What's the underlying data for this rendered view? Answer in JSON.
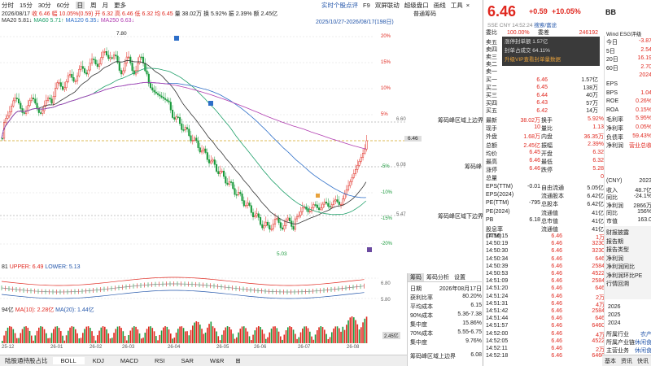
{
  "toolbar": {
    "items": [
      "分时",
      "15分",
      "30分",
      "60分",
      "日",
      "周",
      "月",
      "更多"
    ],
    "active": "日"
  },
  "chart_toolbar": {
    "items": [
      "实时个股点评",
      "F9",
      "双屏联动",
      "超级盘口",
      "画线",
      "工具"
    ],
    "close": "×"
  },
  "ohlc": {
    "date": "2026/08/17",
    "close": "收 6.46",
    "change": "幅 10.05%(0.59)",
    "open": "开 6.32",
    "high": "高 6.46",
    "low": "低 6.32",
    "prevclose": "均 6.45",
    "volume": "量 38.02万",
    "turnover": "换 5.92%",
    "amplitude": "振 2.39%",
    "amount": "额 2.45亿"
  },
  "ma": {
    "ma20": "MA20 5.81↓",
    "ma60": "MA60 5.71↑",
    "ma120": "MA120 6.35↓",
    "ma250": "MA250 6.63↓"
  },
  "range_label": "2025/10/27-2026/08/17(198日)",
  "chip_title": "普通筹码",
  "price_axis": [
    "20%",
    "15%",
    "10%",
    "5%",
    "",
    "-5%",
    "-10%",
    "-15%",
    "-20%"
  ],
  "price_marks": {
    "high": "7.80",
    "low": "5.03",
    "close_tag": "6.46",
    "r660": "6.60",
    "r608": "6.08",
    "r547": "5.47"
  },
  "chip_labels": {
    "upper": "筹码峰区域上边界",
    "peak": "筹码峰",
    "lower": "筹码峰区域下边界"
  },
  "boll": {
    "label": "81",
    "upper": "UPPER: 6.49",
    "lower": "LOWER: 5.13",
    "axis": [
      "6.80",
      "5.80"
    ]
  },
  "vol": {
    "label": "94亿",
    "ma10": "MA(10): 2.28亿",
    "ma20": "MA(20): 1.44亿",
    "axis": [
      "2.45亿"
    ]
  },
  "x_dates": [
    "25-12",
    "26-01",
    "26-02",
    "26-03",
    "26-04",
    "26-05",
    "26-06",
    "26-07",
    "26-08"
  ],
  "bottom_tabs": [
    "陆股通持股占比",
    "BOLL",
    "KDJ",
    "MACD",
    "RSI",
    "SAR",
    "W&R"
  ],
  "bottom_active": "BOLL",
  "chip_panel": {
    "tabs": [
      "筹码",
      "筹码分析",
      "设置"
    ],
    "rows": [
      [
        "日期",
        "2026年08月17日"
      ],
      [
        "获利比率",
        "80.20%"
      ],
      [
        "平均成本",
        "6.15"
      ],
      [
        "90%成本",
        "5.36-7.38"
      ],
      [
        "集中度",
        "15.86%"
      ],
      [
        "70%成本",
        "5.55-6.75"
      ],
      [
        "集中度",
        "9.76%"
      ]
    ],
    "footer": [
      "筹码峰区域上边界",
      "6.08"
    ]
  },
  "quote": {
    "price": "6.46",
    "change": "+0.59",
    "pct": "+10.05%",
    "sub": "SSE CNY 14:52:24",
    "sub2": "搜索/富途",
    "sub3": "BB",
    "esg": "Wind ESG评级"
  },
  "orderbook_header": [
    [
      "委比",
      "100.00%",
      "委差",
      "246192"
    ]
  ],
  "limit_box": [
    "涨停封单额 1.57亿",
    "封单占成交 64.11%",
    "升级VIP查看封单量数据"
  ],
  "asks": [
    [
      "卖五",
      "",
      ""
    ],
    [
      "卖四",
      "",
      ""
    ],
    [
      "卖三",
      "",
      ""
    ],
    [
      "卖二",
      "",
      ""
    ],
    [
      "卖一",
      "",
      ""
    ]
  ],
  "bids": [
    [
      "买一",
      "6.46",
      "1.57亿"
    ],
    [
      "买二",
      "6.45",
      "138万"
    ],
    [
      "买三",
      "6.44",
      "40万"
    ],
    [
      "买四",
      "6.43",
      "57万"
    ],
    [
      "买五",
      "6.42",
      "14万"
    ]
  ],
  "stats": [
    [
      "最新",
      "38.02万",
      "换手",
      "5.92%"
    ],
    [
      "现手",
      "10",
      "量比",
      "1.13"
    ],
    [
      "外盘",
      "1.68万",
      "内盘",
      "36.35万"
    ],
    [
      "总额",
      "2.45亿",
      "振幅",
      "2.39%"
    ],
    [
      "均价",
      "6.45",
      "开盘",
      "6.32"
    ],
    [
      "最高",
      "6.46",
      "最低",
      "6.32"
    ],
    [
      "涨停",
      "6.46",
      "跌停",
      "5.28"
    ],
    [
      "总量",
      "",
      "",
      "0"
    ]
  ],
  "fin": [
    [
      "EPS(TTM)",
      "-0.01",
      "自由流通",
      "5.05亿"
    ],
    [
      "EPS(2024)",
      "",
      "流通股本",
      "6.42亿"
    ],
    [
      "PE(TTM)",
      "-795",
      "总股本",
      "6.42亿"
    ],
    [
      "PE(2024)",
      "",
      "流通值",
      "41亿"
    ],
    [
      "PB",
      "6.18",
      "总市值",
      "41亿"
    ],
    [
      "股息率(TTM)",
      "",
      "流通值",
      "41亿"
    ]
  ],
  "ticks": [
    [
      "14:50:15",
      "6.46",
      "1万"
    ],
    [
      "14:50:19",
      "6.46",
      "3230"
    ],
    [
      "14:50:30",
      "6.46",
      "3230"
    ],
    [
      "14:50:34",
      "6.46",
      "646"
    ],
    [
      "14:50:39",
      "6.46",
      "2584"
    ],
    [
      "14:50:53",
      "6.46",
      "4522"
    ],
    [
      "14:51:09",
      "6.46",
      "2584"
    ],
    [
      "14:51:20",
      "6.46",
      "646"
    ],
    [
      "14:51:24",
      "6.46",
      "2万"
    ],
    [
      "14:51:31",
      "6.46",
      "4万"
    ],
    [
      "14:51:42",
      "6.46",
      "2584"
    ],
    [
      "14:51:44",
      "6.46",
      "646"
    ],
    [
      "14:51:57",
      "6.46",
      "6460"
    ],
    [
      "14:52:00",
      "6.46",
      "4万"
    ],
    [
      "14:52:05",
      "6.46",
      "4522"
    ],
    [
      "14:52:11",
      "6.46",
      "2万"
    ],
    [
      "14:52:18",
      "6.46",
      "6460"
    ]
  ],
  "right_stats": [
    [
      "今日",
      "-3.87"
    ],
    [
      "5日",
      "2.54"
    ],
    [
      "20日",
      "16.19"
    ],
    [
      "60日",
      "2.70"
    ],
    [
      "",
      "2024"
    ],
    [
      "EPS",
      ""
    ],
    [
      "BPS",
      "1.04"
    ],
    [
      "ROE",
      "0.26%"
    ],
    [
      "ROA",
      "0.15%"
    ],
    [
      "毛利率",
      "5.95%"
    ],
    [
      "净利率",
      "0.05%"
    ],
    [
      "负债率",
      "59.43%"
    ],
    [
      "净利润",
      "营业总收"
    ]
  ],
  "right_fin": [
    [
      "(CNY)",
      "2023"
    ],
    [
      "收入",
      "48.7亿"
    ],
    [
      "同比",
      "-24.1%"
    ],
    [
      "净利润",
      "2866万"
    ],
    [
      "同比",
      "156%"
    ],
    [
      "市值",
      "163.0"
    ]
  ],
  "right_menu": [
    "财报披露",
    "报告期",
    "报告类型",
    "净利润",
    "净利润同比",
    "净利润环比PE",
    "行情回溯"
  ],
  "right_years": [
    "2026",
    "2025",
    "2024"
  ],
  "industry": [
    [
      "所属行业",
      "农产"
    ],
    [
      "所属产业链",
      "休闲食"
    ],
    [
      "主营业务",
      "休闲食"
    ]
  ],
  "right_tabs": [
    "基本",
    "资讯",
    "快讯"
  ]
}
